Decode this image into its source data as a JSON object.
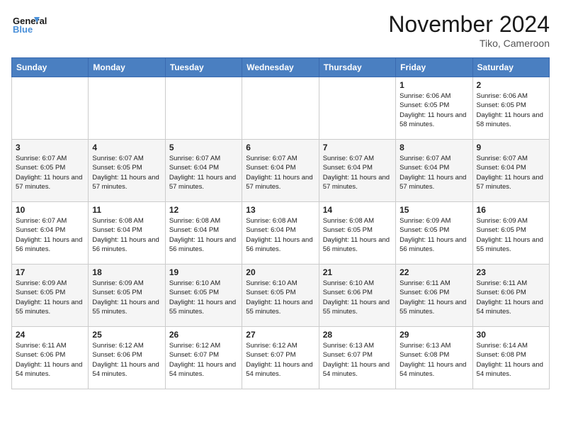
{
  "header": {
    "logo_line1": "General",
    "logo_line2": "Blue",
    "month_title": "November 2024",
    "location": "Tiko, Cameroon"
  },
  "days_of_week": [
    "Sunday",
    "Monday",
    "Tuesday",
    "Wednesday",
    "Thursday",
    "Friday",
    "Saturday"
  ],
  "weeks": [
    [
      {
        "num": "",
        "info": ""
      },
      {
        "num": "",
        "info": ""
      },
      {
        "num": "",
        "info": ""
      },
      {
        "num": "",
        "info": ""
      },
      {
        "num": "",
        "info": ""
      },
      {
        "num": "1",
        "info": "Sunrise: 6:06 AM\nSunset: 6:05 PM\nDaylight: 11 hours and 58 minutes."
      },
      {
        "num": "2",
        "info": "Sunrise: 6:06 AM\nSunset: 6:05 PM\nDaylight: 11 hours and 58 minutes."
      }
    ],
    [
      {
        "num": "3",
        "info": "Sunrise: 6:07 AM\nSunset: 6:05 PM\nDaylight: 11 hours and 57 minutes."
      },
      {
        "num": "4",
        "info": "Sunrise: 6:07 AM\nSunset: 6:05 PM\nDaylight: 11 hours and 57 minutes."
      },
      {
        "num": "5",
        "info": "Sunrise: 6:07 AM\nSunset: 6:04 PM\nDaylight: 11 hours and 57 minutes."
      },
      {
        "num": "6",
        "info": "Sunrise: 6:07 AM\nSunset: 6:04 PM\nDaylight: 11 hours and 57 minutes."
      },
      {
        "num": "7",
        "info": "Sunrise: 6:07 AM\nSunset: 6:04 PM\nDaylight: 11 hours and 57 minutes."
      },
      {
        "num": "8",
        "info": "Sunrise: 6:07 AM\nSunset: 6:04 PM\nDaylight: 11 hours and 57 minutes."
      },
      {
        "num": "9",
        "info": "Sunrise: 6:07 AM\nSunset: 6:04 PM\nDaylight: 11 hours and 57 minutes."
      }
    ],
    [
      {
        "num": "10",
        "info": "Sunrise: 6:07 AM\nSunset: 6:04 PM\nDaylight: 11 hours and 56 minutes."
      },
      {
        "num": "11",
        "info": "Sunrise: 6:08 AM\nSunset: 6:04 PM\nDaylight: 11 hours and 56 minutes."
      },
      {
        "num": "12",
        "info": "Sunrise: 6:08 AM\nSunset: 6:04 PM\nDaylight: 11 hours and 56 minutes."
      },
      {
        "num": "13",
        "info": "Sunrise: 6:08 AM\nSunset: 6:04 PM\nDaylight: 11 hours and 56 minutes."
      },
      {
        "num": "14",
        "info": "Sunrise: 6:08 AM\nSunset: 6:05 PM\nDaylight: 11 hours and 56 minutes."
      },
      {
        "num": "15",
        "info": "Sunrise: 6:09 AM\nSunset: 6:05 PM\nDaylight: 11 hours and 56 minutes."
      },
      {
        "num": "16",
        "info": "Sunrise: 6:09 AM\nSunset: 6:05 PM\nDaylight: 11 hours and 55 minutes."
      }
    ],
    [
      {
        "num": "17",
        "info": "Sunrise: 6:09 AM\nSunset: 6:05 PM\nDaylight: 11 hours and 55 minutes."
      },
      {
        "num": "18",
        "info": "Sunrise: 6:09 AM\nSunset: 6:05 PM\nDaylight: 11 hours and 55 minutes."
      },
      {
        "num": "19",
        "info": "Sunrise: 6:10 AM\nSunset: 6:05 PM\nDaylight: 11 hours and 55 minutes."
      },
      {
        "num": "20",
        "info": "Sunrise: 6:10 AM\nSunset: 6:05 PM\nDaylight: 11 hours and 55 minutes."
      },
      {
        "num": "21",
        "info": "Sunrise: 6:10 AM\nSunset: 6:06 PM\nDaylight: 11 hours and 55 minutes."
      },
      {
        "num": "22",
        "info": "Sunrise: 6:11 AM\nSunset: 6:06 PM\nDaylight: 11 hours and 55 minutes."
      },
      {
        "num": "23",
        "info": "Sunrise: 6:11 AM\nSunset: 6:06 PM\nDaylight: 11 hours and 54 minutes."
      }
    ],
    [
      {
        "num": "24",
        "info": "Sunrise: 6:11 AM\nSunset: 6:06 PM\nDaylight: 11 hours and 54 minutes."
      },
      {
        "num": "25",
        "info": "Sunrise: 6:12 AM\nSunset: 6:06 PM\nDaylight: 11 hours and 54 minutes."
      },
      {
        "num": "26",
        "info": "Sunrise: 6:12 AM\nSunset: 6:07 PM\nDaylight: 11 hours and 54 minutes."
      },
      {
        "num": "27",
        "info": "Sunrise: 6:12 AM\nSunset: 6:07 PM\nDaylight: 11 hours and 54 minutes."
      },
      {
        "num": "28",
        "info": "Sunrise: 6:13 AM\nSunset: 6:07 PM\nDaylight: 11 hours and 54 minutes."
      },
      {
        "num": "29",
        "info": "Sunrise: 6:13 AM\nSunset: 6:08 PM\nDaylight: 11 hours and 54 minutes."
      },
      {
        "num": "30",
        "info": "Sunrise: 6:14 AM\nSunset: 6:08 PM\nDaylight: 11 hours and 54 minutes."
      }
    ]
  ]
}
